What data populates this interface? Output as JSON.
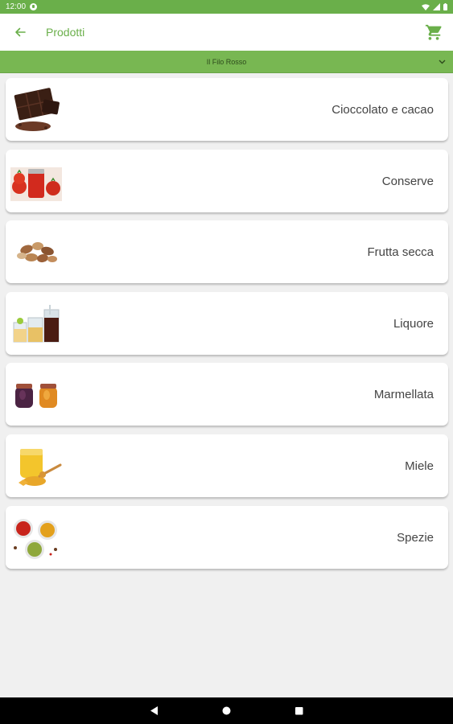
{
  "status_bar": {
    "time": "12:00"
  },
  "app_bar": {
    "title": "Prodotti"
  },
  "shop_bar": {
    "shop_name": "Il Filo Rosso"
  },
  "categories": [
    {
      "label": "Cioccolato e cacao",
      "icon": "chocolate-image"
    },
    {
      "label": "Conserve",
      "icon": "preserves-image"
    },
    {
      "label": "Frutta secca",
      "icon": "nuts-image"
    },
    {
      "label": "Liquore",
      "icon": "liqueur-image"
    },
    {
      "label": "Marmellata",
      "icon": "jam-image"
    },
    {
      "label": "Miele",
      "icon": "honey-image"
    },
    {
      "label": "Spezie",
      "icon": "spices-image"
    }
  ],
  "colors": {
    "accent": "#6aaf4a",
    "shop_bar": "#78b752",
    "background": "#f0f0f0"
  }
}
